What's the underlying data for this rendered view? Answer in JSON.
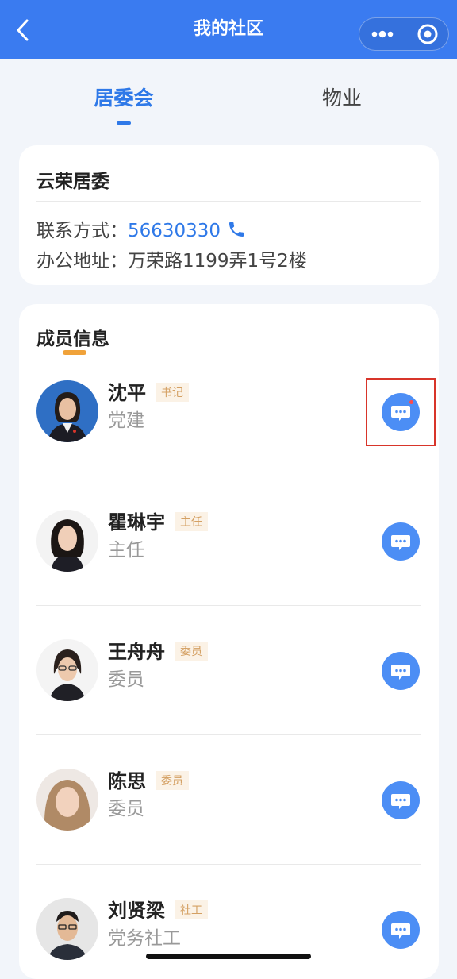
{
  "navbar": {
    "title": "我的社区",
    "back_icon": "chevron-left-icon",
    "more_icon": "more-dots-icon",
    "close_icon": "target-circle-icon",
    "color": "#3a7bf0"
  },
  "tabs": [
    {
      "label": "居委会",
      "active": true
    },
    {
      "label": "物业",
      "active": false
    }
  ],
  "office": {
    "name": "云荣居委",
    "contact_label": "联系方式：",
    "phone": "56630330",
    "address_label": "办公地址：",
    "address": "万荣路1199弄1号2楼"
  },
  "members": {
    "title": "成员信息",
    "items": [
      {
        "name": "沈平",
        "badge": "书记",
        "role": "党建",
        "unread": true
      },
      {
        "name": "瞿琳宇",
        "badge": "主任",
        "role": "主任",
        "unread": false
      },
      {
        "name": "王舟舟",
        "badge": "委员",
        "role": "委员",
        "unread": false
      },
      {
        "name": "陈思",
        "badge": "委员",
        "role": "委员",
        "unread": false
      },
      {
        "name": "刘贤梁",
        "badge": "社工",
        "role": "党务社工",
        "unread": false
      }
    ]
  },
  "colors": {
    "accent": "#2f79e8",
    "badge_text": "#d4a063",
    "badge_bg": "#fbf2e6",
    "chat_button": "#4c8ef5",
    "highlight": "#d8352a"
  }
}
